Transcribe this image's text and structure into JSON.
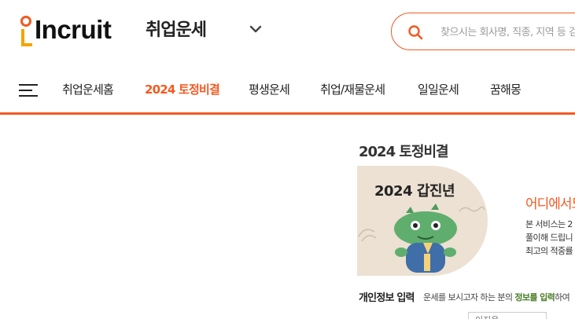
{
  "header": {
    "logo_text": "Incruit",
    "service_name": "취업운세",
    "search": {
      "placeholder": "찾으시는 회사명, 직종, 지역 등 검색"
    }
  },
  "nav": {
    "items": [
      {
        "label": "취업운세홈",
        "active": false
      },
      {
        "label": "2024 토정비결",
        "active": true
      },
      {
        "label": "평생운세",
        "active": false
      },
      {
        "label": "취업/재물운세",
        "active": false
      },
      {
        "label": "일일운세",
        "active": false
      },
      {
        "label": "꿈해몽",
        "active": false
      }
    ]
  },
  "main": {
    "section_title": "2024 토정비결",
    "banner": {
      "year_text": "2024 갑진년",
      "heading": "어디에서도",
      "desc_lines": [
        "본 서비스는 2",
        "풀이해 드립니",
        "최고의 적중률"
      ]
    },
    "form": {
      "title": "개인정보 입력",
      "desc_before": "운세를 보시고자 하는 분의 ",
      "desc_highlight": "정보를 입력",
      "desc_after": "하여",
      "select_value": "이지은"
    }
  },
  "colors": {
    "brand": "#f15a22",
    "accent_yellow": "#f5a300",
    "highlight_green": "#4a7e2a"
  }
}
